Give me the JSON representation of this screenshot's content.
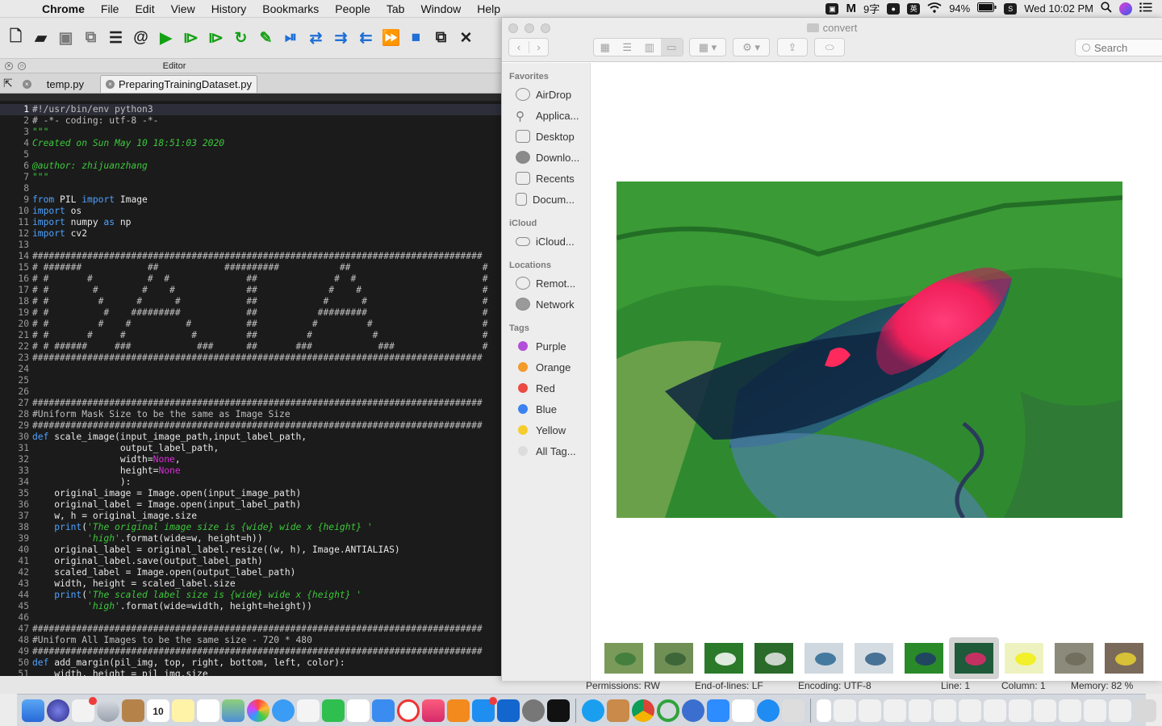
{
  "menubar": {
    "app": "Chrome",
    "items": [
      "File",
      "Edit",
      "View",
      "History",
      "Bookmarks",
      "People",
      "Tab",
      "Window",
      "Help"
    ],
    "input_method": "9字",
    "ime_label": "英",
    "battery": "94%",
    "datetime": "Wed 10:02 PM"
  },
  "spyder": {
    "editor_title": "Editor",
    "tabs": [
      {
        "name": "temp.py",
        "active": false
      },
      {
        "name": "PreparingTrainingDataset.py",
        "active": true
      }
    ],
    "code_lines": [
      [
        [
          "c",
          "#!/usr/bin/env python3"
        ]
      ],
      [
        [
          "c",
          "# -*- coding: utf-8 -*-"
        ]
      ],
      [
        [
          "d",
          "\"\"\""
        ]
      ],
      [
        [
          "d",
          "Created on Sun May 10 18:51:03 2020"
        ]
      ],
      [
        [
          "d",
          ""
        ]
      ],
      [
        [
          "d",
          "@author: zhijuanzhang"
        ]
      ],
      [
        [
          "d",
          "\"\"\""
        ]
      ],
      [
        [
          "n",
          ""
        ]
      ],
      [
        [
          "k",
          "from"
        ],
        [
          "n",
          " PIL "
        ],
        [
          "k",
          "import"
        ],
        [
          "n",
          " Image"
        ]
      ],
      [
        [
          "k",
          "import"
        ],
        [
          "n",
          " os"
        ]
      ],
      [
        [
          "k",
          "import"
        ],
        [
          "n",
          " numpy "
        ],
        [
          "k",
          "as"
        ],
        [
          "n",
          " np"
        ]
      ],
      [
        [
          "k",
          "import"
        ],
        [
          "n",
          " cv2"
        ]
      ],
      [
        [
          "n",
          ""
        ]
      ],
      [
        [
          "c",
          "##################################################################################"
        ]
      ],
      [
        [
          "c",
          "# #######            ##            ##########           ##                        #"
        ]
      ],
      [
        [
          "c",
          "# #       #          #  #              ##              #  #                       #"
        ]
      ],
      [
        [
          "c",
          "# #        #        #    #             ##             #    #                      #"
        ]
      ],
      [
        [
          "c",
          "# #         #      #      #            ##            #      #                     #"
        ]
      ],
      [
        [
          "c",
          "# #          #    #########            ##           #########                     #"
        ]
      ],
      [
        [
          "c",
          "# #         #    #          #          ##          #         #                    #"
        ]
      ],
      [
        [
          "c",
          "# #       #     #            #         ##         #           #                   #"
        ]
      ],
      [
        [
          "c",
          "# # ######     ###            ###      ##       ###            ###                #"
        ]
      ],
      [
        [
          "c",
          "##################################################################################"
        ]
      ],
      [
        [
          "n",
          ""
        ]
      ],
      [
        [
          "n",
          ""
        ]
      ],
      [
        [
          "n",
          ""
        ]
      ],
      [
        [
          "c",
          "##################################################################################"
        ]
      ],
      [
        [
          "c",
          "#Uniform Mask Size to be the same as Image Size"
        ]
      ],
      [
        [
          "c",
          "##################################################################################"
        ]
      ],
      [
        [
          "k",
          "def"
        ],
        [
          "n",
          " scale_image(input_image_path,input_label_path,"
        ]
      ],
      [
        [
          "n",
          "                output_label_path,"
        ]
      ],
      [
        [
          "n",
          "                width="
        ],
        [
          "p",
          "None"
        ],
        [
          "n",
          ","
        ]
      ],
      [
        [
          "n",
          "                height="
        ],
        [
          "p",
          "None"
        ]
      ],
      [
        [
          "n",
          "                ):"
        ]
      ],
      [
        [
          "n",
          "    original_image = Image.open(input_image_path)"
        ]
      ],
      [
        [
          "n",
          "    original_label = Image.open(input_label_path)"
        ]
      ],
      [
        [
          "n",
          "    w, h = original_image.size"
        ]
      ],
      [
        [
          "n",
          "    "
        ],
        [
          "k",
          "print"
        ],
        [
          "n",
          "("
        ],
        [
          "s",
          "'The original image size is {wide} wide x {height} '"
        ]
      ],
      [
        [
          "n",
          "          "
        ],
        [
          "s",
          "'high'"
        ],
        [
          "n",
          ".format(wide=w, height=h))"
        ]
      ],
      [
        [
          "n",
          "    original_label = original_label.resize((w, h), Image.ANTIALIAS)"
        ]
      ],
      [
        [
          "n",
          "    original_label.save(output_label_path)"
        ]
      ],
      [
        [
          "n",
          "    scaled_label = Image.open(output_label_path)"
        ]
      ],
      [
        [
          "n",
          "    width, height = scaled_label.size"
        ]
      ],
      [
        [
          "n",
          "    "
        ],
        [
          "k",
          "print"
        ],
        [
          "n",
          "("
        ],
        [
          "s",
          "'The scaled label size is {wide} wide x {height} '"
        ]
      ],
      [
        [
          "n",
          "          "
        ],
        [
          "s",
          "'high'"
        ],
        [
          "n",
          ".format(wide=width, height=height))"
        ]
      ],
      [
        [
          "n",
          ""
        ]
      ],
      [
        [
          "c",
          "##################################################################################"
        ]
      ],
      [
        [
          "c",
          "#Uniform All Images to be the same size - 720 * 480"
        ]
      ],
      [
        [
          "c",
          "##################################################################################"
        ]
      ],
      [
        [
          "k",
          "def"
        ],
        [
          "n",
          " add_margin(pil_img, top, right, bottom, left, color):"
        ]
      ],
      [
        [
          "n",
          "    width, height = pil_img.size"
        ]
      ]
    ],
    "status": {
      "permissions": "Permissions:  RW",
      "eol": "End-of-lines:  LF",
      "encoding": "Encoding:  UTF-8",
      "line": "Line:  1",
      "column": "Column:  1",
      "memory": "Memory:  82 %"
    }
  },
  "finder": {
    "title": "convert",
    "search_placeholder": "Search",
    "favorites_header": "Favorites",
    "favorites": [
      "AirDrop",
      "Applica...",
      "Desktop",
      "Downlo...",
      "Recents",
      "Docum..."
    ],
    "icloud_header": "iCloud",
    "icloud": [
      "iCloud..."
    ],
    "locations_header": "Locations",
    "locations": [
      "Remot...",
      "Network"
    ],
    "tags_header": "Tags",
    "tags": [
      {
        "label": "Purple",
        "color": "#b24fd8"
      },
      {
        "label": "Orange",
        "color": "#f39a2b"
      },
      {
        "label": "Red",
        "color": "#ec4a41"
      },
      {
        "label": "Blue",
        "color": "#3b82f0"
      },
      {
        "label": "Yellow",
        "color": "#f5cc2f"
      },
      {
        "label": "All Tag...",
        "color": "#dcdcdc"
      }
    ],
    "thumbnail_count": 11,
    "selected_thumbnail": 7
  },
  "dock": {
    "calendar_day": "10",
    "mail_badge": "101,402"
  }
}
